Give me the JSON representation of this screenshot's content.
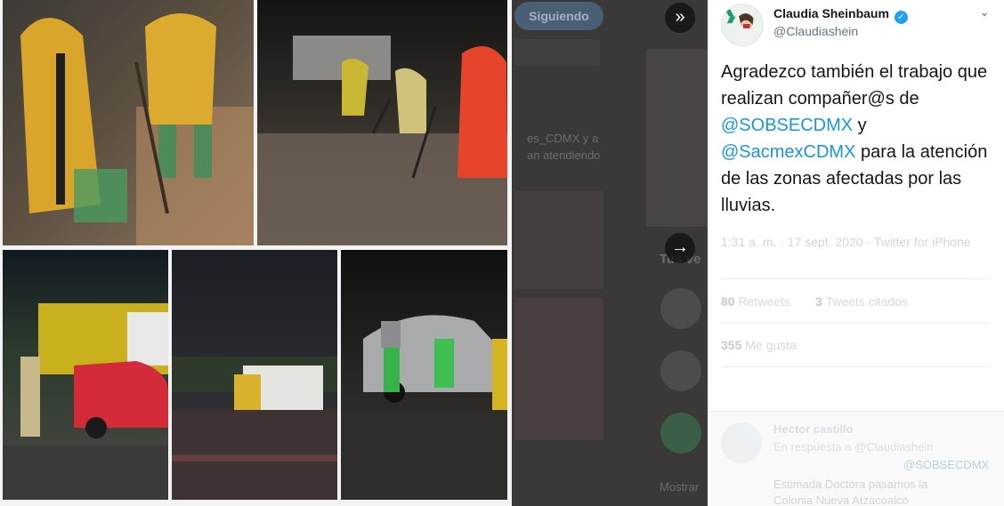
{
  "background": {
    "follow_button": "Siguiendo",
    "snippet_1": "es_CDMX y a",
    "snippet_2": "an atendiendo",
    "section_label": "Tus ve",
    "show_more": "Mostrar"
  },
  "controls": {
    "collapse_icon": "double-chevron-right-icon",
    "next_icon": "arrow-right-icon"
  },
  "tweet": {
    "author_name": "Claudia Sheinbaum",
    "author_handle": "@Claudiashein",
    "verified_badge": "✓",
    "text_line1": "Agradezco también el trabajo que realizan compañer@s de ",
    "mention1": "@SOBSECDMX",
    "text_line2": " y ",
    "mention2": "@SacmexCDMX",
    "text_line3": " para la atención de las zonas afectadas por las lluvias.",
    "timestamp": "1:31 a. m. · 17 sept. 2020 · Twitter for iPhone",
    "retweets_count": "80",
    "retweets_label": "Retweets",
    "quotes_count": "3",
    "quotes_label": "Tweets citados",
    "likes_count": "355",
    "likes_label": "Me gusta"
  },
  "reply": {
    "author": "Hector castillo",
    "line1": "En respuesta a @Claudiashein",
    "line2": "@SOBSECDMX",
    "line3": "Estimada  Doctora  pasamos  la",
    "line4": "Colonia Nueva Atzacoalco"
  },
  "colors": {
    "mention": "#1b95e0",
    "verified": "#1da1f2",
    "text": "#14171a",
    "muted": "#657786"
  }
}
